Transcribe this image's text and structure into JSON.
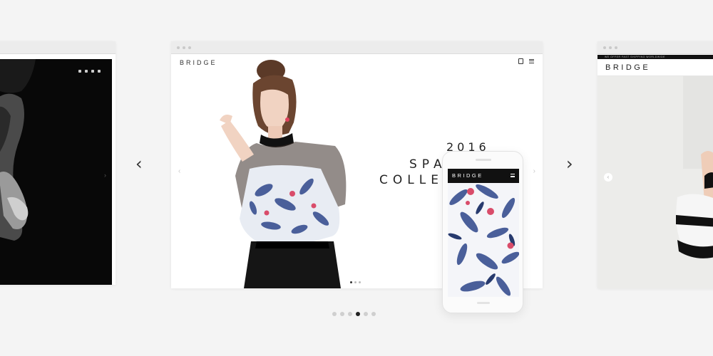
{
  "brand": {
    "logo_text": "BRIDGE"
  },
  "left_slide": {
    "social_icons": [
      "facebook-icon",
      "twitter-icon",
      "vimeo-icon",
      "instagram-icon"
    ],
    "next_arrow": "›"
  },
  "center_slide": {
    "year": "2016",
    "headline_line1": "SPA",
    "headline_line2": "COLLEC",
    "prev_arrow": "‹",
    "next_arrow": "›",
    "slide_dots": 3,
    "active_slide_dot": 0
  },
  "phone": {
    "logo_text": "BRIDGE"
  },
  "right_slide": {
    "topbar_text": "WE OFFER FAST SHIPPING WORLDWIDE",
    "logo_text": "BRIDGE",
    "prev_arrow": "‹"
  },
  "carousel": {
    "prev_arrow": "‹",
    "next_arrow": "›",
    "dots": 6,
    "active_dot": 3
  },
  "colors": {
    "background": "#f4f4f4",
    "dark": "#111111",
    "floral_blue": "#4a5f9a",
    "floral_pink": "#d94c6a"
  }
}
